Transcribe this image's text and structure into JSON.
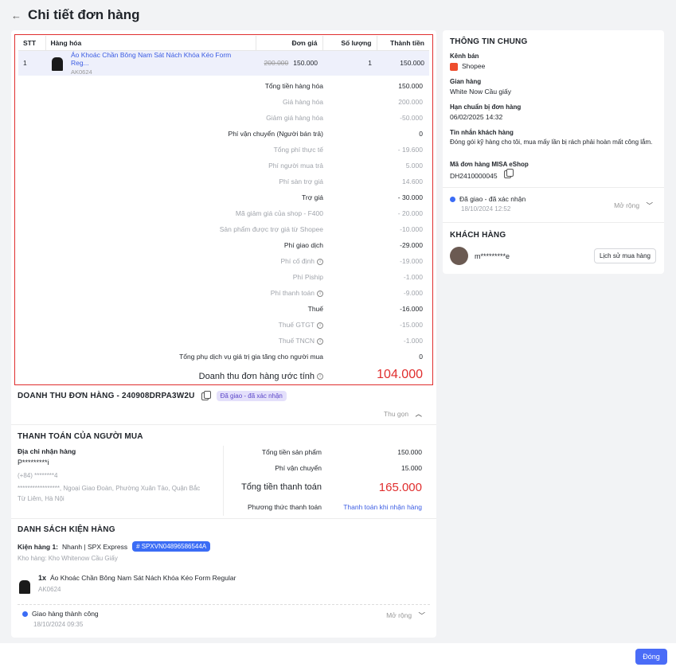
{
  "header": {
    "back_icon": "arrow-left-icon",
    "title": "Chi tiết đơn hàng"
  },
  "table": {
    "headers": [
      "STT",
      "Hàng hóa",
      "Đơn giá",
      "Số lượng",
      "Thành tiền"
    ],
    "row": {
      "stt": "1",
      "name": "Áo Khoác Chần Bông Nam Sát Nách Khóa Kéo Form Reg...",
      "sku": "AK0624",
      "old_price": "200.000",
      "price": "150.000",
      "qty": "1",
      "total": "150.000"
    }
  },
  "summary": [
    {
      "label": "Tổng tiền hàng hóa",
      "value": "150.000",
      "kind": "main",
      "info": false
    },
    {
      "label": "Giá hàng hóa",
      "value": "200.000",
      "kind": "sub",
      "info": false
    },
    {
      "label": "Giảm giá hàng hóa",
      "value": "-50.000",
      "kind": "sub",
      "info": false
    },
    {
      "label": "Phí vận chuyển (Người bán trả)",
      "value": "0",
      "kind": "main",
      "info": false
    },
    {
      "label": "Tổng phí thực tế",
      "value": "- 19.600",
      "kind": "sub",
      "info": false
    },
    {
      "label": "Phí người mua trả",
      "value": "5.000",
      "kind": "sub",
      "info": false
    },
    {
      "label": "Phí sàn trợ giá",
      "value": "14.600",
      "kind": "sub",
      "info": false
    },
    {
      "label": "Trợ giá",
      "value": "- 30.000",
      "kind": "main",
      "info": false
    },
    {
      "label": "Mã giảm giá của shop - F400",
      "value": "- 20.000",
      "kind": "sub",
      "info": false
    },
    {
      "label": "Sản phẩm được trợ giá từ Shopee",
      "value": "-10.000",
      "kind": "sub",
      "info": false
    },
    {
      "label": "Phí giao dịch",
      "value": "-29.000",
      "kind": "main",
      "info": false
    },
    {
      "label": "Phí cố định",
      "value": "-19.000",
      "kind": "sub",
      "info": true
    },
    {
      "label": "Phí Piship",
      "value": "-1.000",
      "kind": "sub",
      "info": false
    },
    {
      "label": "Phí thanh toán",
      "value": "-9.000",
      "kind": "sub",
      "info": true
    },
    {
      "label": "Thuế",
      "value": "-16.000",
      "kind": "main",
      "info": false
    },
    {
      "label": "Thuế GTGT",
      "value": "-15.000",
      "kind": "sub",
      "info": true
    },
    {
      "label": "Thuế TNCN",
      "value": "-1.000",
      "kind": "sub",
      "info": true
    },
    {
      "label": "Tổng phụ dịch vụ giá trị gia tăng cho người mua",
      "value": "0",
      "kind": "main",
      "info": false
    }
  ],
  "revenue": {
    "label": "Doanh thu đơn hàng ước tính",
    "value": "104.000"
  },
  "order": {
    "title": "DOANH THU ĐƠN HÀNG - 240908DRPA3W2U",
    "status": "Đã giao - đã xác nhận",
    "collapse": "Thu gọn"
  },
  "payment": {
    "title": "THANH TOÁN CỦA NGƯỜI MUA",
    "address_label": "Địa chỉ nhận hàng",
    "name": "P*********i",
    "phone": "(+84) ********4",
    "address": "*****************, Ngoại Giao Đoàn, Phường Xuân Tảo, Quận Bắc Từ Liêm, Hà Nội",
    "rows": {
      "products_label": "Tổng tiền sản phẩm",
      "products_value": "150.000",
      "shipping_label": "Phí vận chuyển",
      "shipping_value": "15.000",
      "total_label": "Tổng tiền thanh toán",
      "total_value": "165.000",
      "method_label": "Phương thức thanh toán",
      "method_value": "Thanh toán khi nhận hàng"
    }
  },
  "packages": {
    "title": "DANH SÁCH KIỆN HÀNG",
    "pkg_label": "Kiện hàng 1:",
    "pkg_carrier": "Nhanh | SPX Express",
    "pkg_code": "# SPXVN04896586544A",
    "warehouse": "Kho hàng: Kho Whitenow Cầu Giấy",
    "item_qty": "1x",
    "item_name": "Áo Khoác Chần Bông Nam Sát Nách Khóa Kéo Form Regular",
    "item_sku": "AK0624",
    "delivery_status": "Giao hàng thành công",
    "delivery_date": "18/10/2024 09:35",
    "expand": "Mở rộng"
  },
  "general": {
    "title": "THÔNG TIN CHUNG",
    "channel_label": "Kênh bán",
    "channel_value": "Shopee",
    "shop_label": "Gian hàng",
    "shop_value": "White Now Cầu giấy",
    "deadline_label": "Hạn chuẩn bị đơn hàng",
    "deadline_value": "06/02/2025 14:32",
    "note_label": "Tin nhắn khách hàng",
    "note_value": "Đóng gói kỹ hàng cho tôi, mua mấy lần bị rách phải hoàn mất công lắm.",
    "misa_label": "Mã đơn hàng MISA eShop",
    "misa_value": "DH2410000045",
    "status": "Đã giao - đã xác nhận",
    "status_date": "18/10/2024 12:52",
    "expand": "Mở rộng"
  },
  "customer": {
    "title": "KHÁCH HÀNG",
    "name": "m*********e",
    "history_btn": "Lịch sử mua hàng"
  },
  "footer": {
    "close": "Đóng"
  },
  "colors": {
    "accent": "#4a6cf7",
    "red": "#e02e2e",
    "badge_bg": "#e4e0fb"
  }
}
